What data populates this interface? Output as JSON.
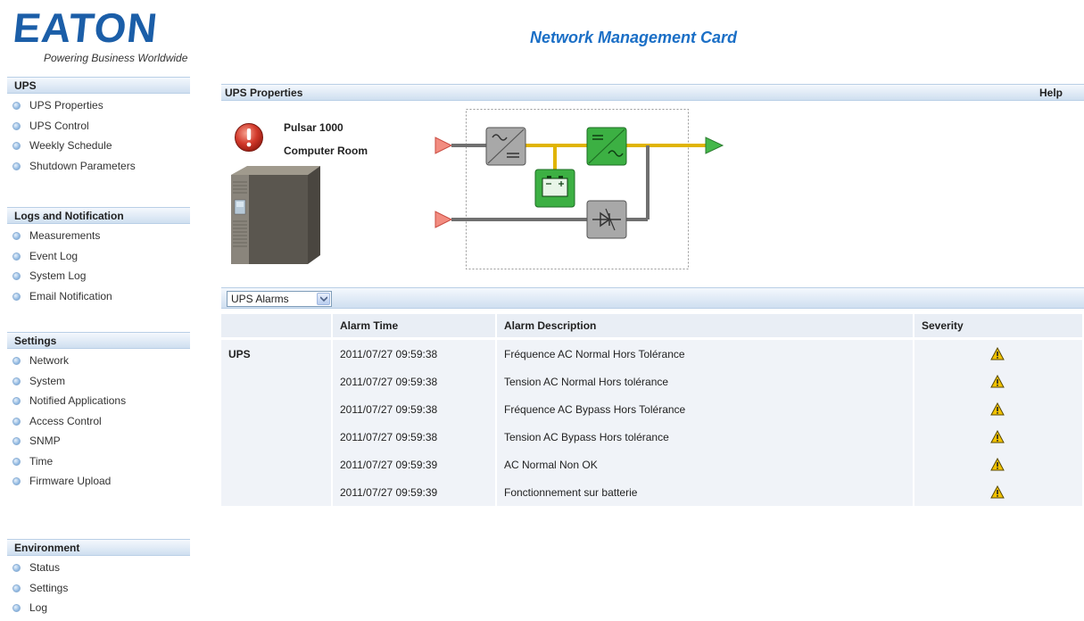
{
  "header": {
    "logo_text": "EATON",
    "logo_tagline": "Powering Business Worldwide",
    "title": "Network Management Card"
  },
  "sidebar": {
    "sections": [
      {
        "title": "UPS",
        "items": [
          "UPS Properties",
          "UPS Control",
          "Weekly Schedule",
          "Shutdown Parameters"
        ]
      },
      {
        "title": "Logs and Notification",
        "items": [
          "Measurements",
          "Event Log",
          "System Log",
          "Email Notification"
        ]
      },
      {
        "title": "Settings",
        "items": [
          "Network",
          "System",
          "Notified Applications",
          "Access Control",
          "SNMP",
          "Time",
          "Firmware Upload"
        ]
      },
      {
        "title": "Environment",
        "items": [
          "Status",
          "Settings",
          "Log"
        ]
      }
    ]
  },
  "main": {
    "panel_title": "UPS Properties",
    "help_label": "Help",
    "model": "Pulsar 1000",
    "location": "Computer Room",
    "alarm_filter": {
      "selected": "UPS Alarms"
    },
    "table": {
      "columns": [
        "",
        "Alarm Time",
        "Alarm Description",
        "Severity"
      ],
      "rows": [
        {
          "object": "UPS",
          "time": "2011/07/27 09:59:38",
          "description": "Fréquence AC Normal Hors Tolérance",
          "severity": "warning-icon"
        },
        {
          "object": "",
          "time": "2011/07/27 09:59:38",
          "description": "Tension AC Normal Hors tolérance",
          "severity": "warning-icon"
        },
        {
          "object": "",
          "time": "2011/07/27 09:59:38",
          "description": "Fréquence AC Bypass Hors Tolérance",
          "severity": "warning-icon"
        },
        {
          "object": "",
          "time": "2011/07/27 09:59:38",
          "description": "Tension AC Bypass Hors tolérance",
          "severity": "warning-icon"
        },
        {
          "object": "",
          "time": "2011/07/27 09:59:39",
          "description": "AC Normal Non OK",
          "severity": "warning-icon"
        },
        {
          "object": "",
          "time": "2011/07/27 09:59:39",
          "description": "Fonctionnement sur batterie",
          "severity": "warning-icon"
        }
      ]
    }
  },
  "colors": {
    "brand": "#1b5ea8",
    "title_blue": "#1b6fc6",
    "section_bar": "#cfdff0",
    "table_row": "#f0f3f8",
    "warning": "#f2c200",
    "alert_red": "#cc2a1e",
    "flow_green": "#3cb043",
    "flow_red": "#e0504a"
  }
}
